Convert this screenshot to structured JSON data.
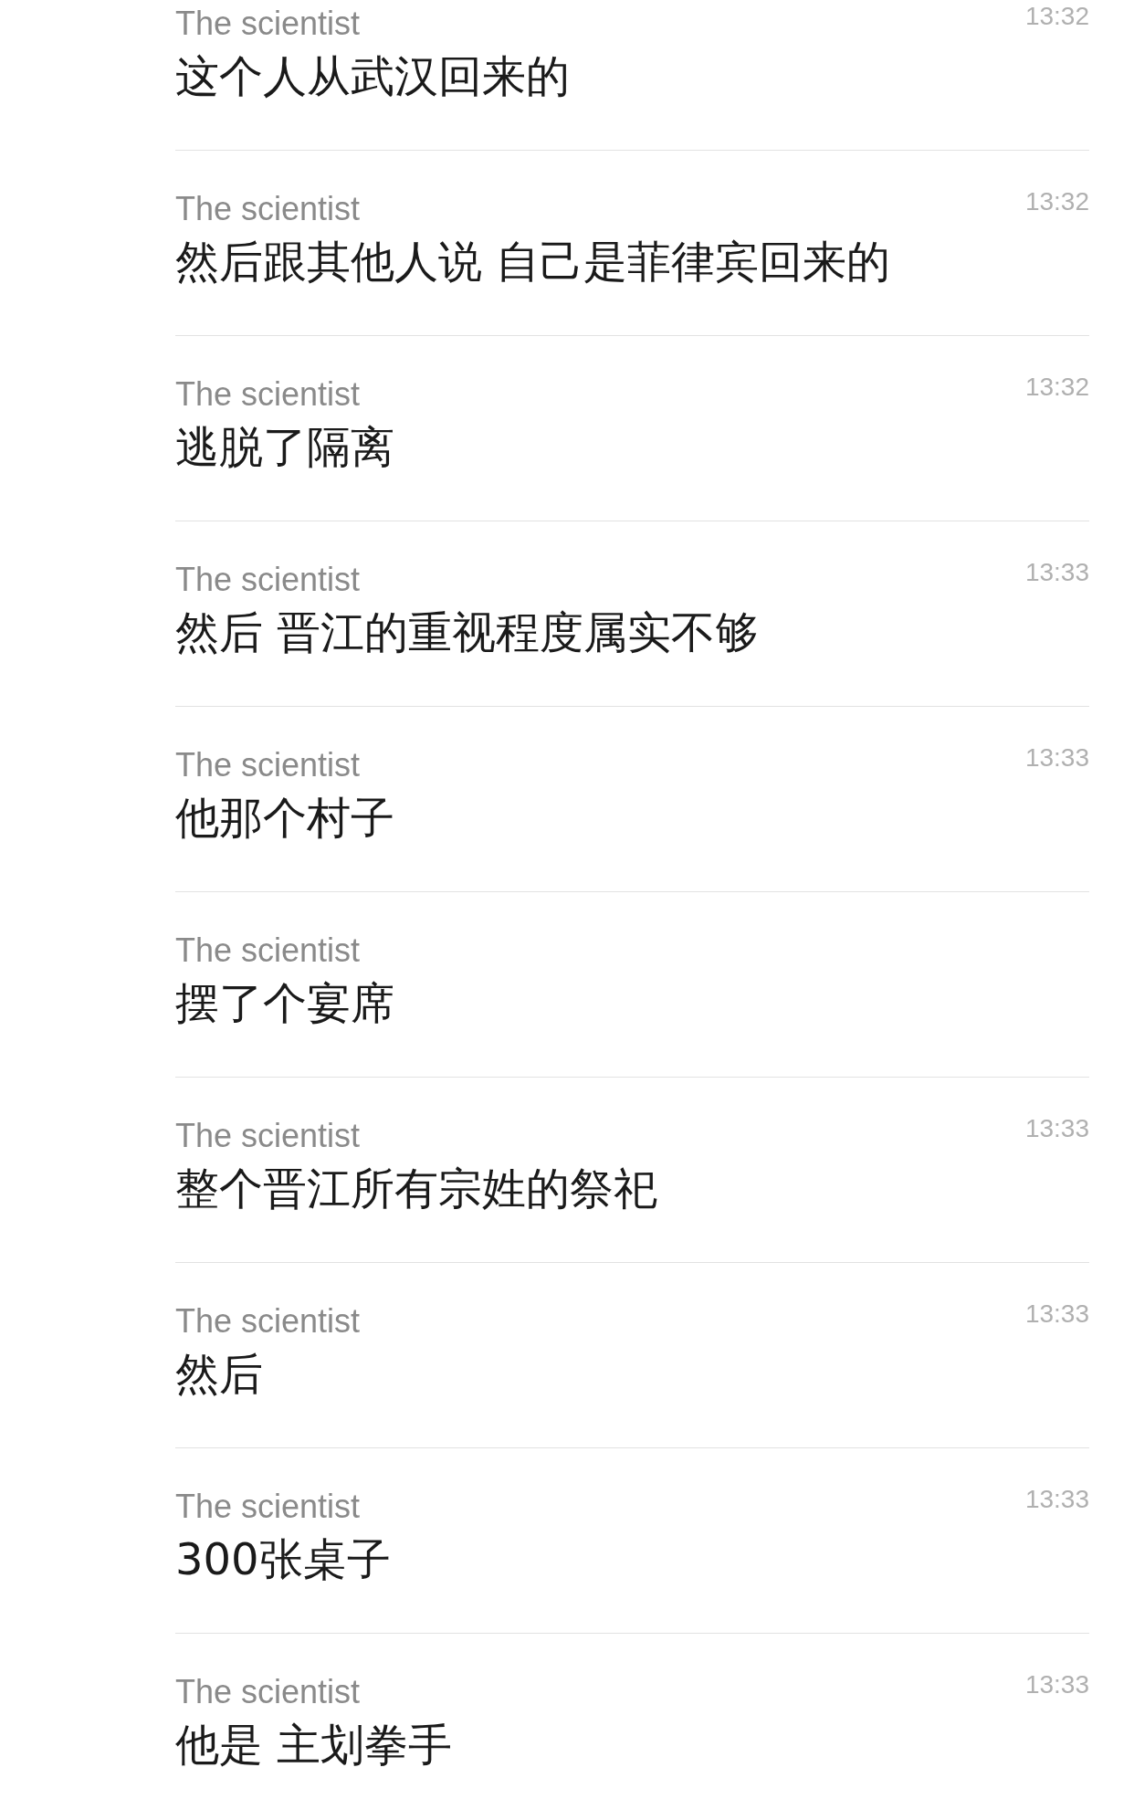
{
  "messages": [
    {
      "sender": "The scientist",
      "time": "13:32",
      "text": "这个人从武汉回来的"
    },
    {
      "sender": "The scientist",
      "time": "13:32",
      "text": "然后跟其他人说 自己是菲律宾回来的"
    },
    {
      "sender": "The scientist",
      "time": "13:32",
      "text": "逃脱了隔离"
    },
    {
      "sender": "The scientist",
      "time": "13:33",
      "text": "然后 晋江的重视程度属实不够"
    },
    {
      "sender": "The scientist",
      "time": "13:33",
      "text": "他那个村子"
    },
    {
      "sender": "The scientist",
      "text": "摆了个宴席"
    },
    {
      "sender": "The scientist",
      "time": "13:33",
      "text": "整个晋江所有宗姓的祭祀"
    },
    {
      "sender": "The scientist",
      "time": "13:33",
      "text": "然后"
    },
    {
      "sender": "The scientist",
      "time": "13:33",
      "text": "300张桌子"
    },
    {
      "sender": "The scientist",
      "time": "13:33",
      "text": "他是 主划拳手"
    }
  ]
}
